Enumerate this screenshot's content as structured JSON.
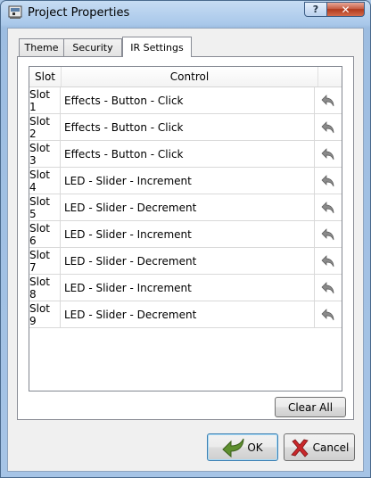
{
  "window": {
    "title": "Project Properties",
    "help_label": "?",
    "close_label": "✕"
  },
  "tabs": [
    {
      "label": "Theme",
      "active": false
    },
    {
      "label": "Security",
      "active": false
    },
    {
      "label": "IR Settings",
      "active": true
    }
  ],
  "table": {
    "columns": [
      "Slot",
      "Control"
    ],
    "rows": [
      {
        "slot": "Slot 1",
        "control": "Effects - Button - Click"
      },
      {
        "slot": "Slot 2",
        "control": "Effects - Button - Click"
      },
      {
        "slot": "Slot 3",
        "control": "Effects - Button - Click"
      },
      {
        "slot": "Slot 4",
        "control": "LED - Slider - Increment"
      },
      {
        "slot": "Slot 5",
        "control": "LED - Slider - Decrement"
      },
      {
        "slot": "Slot 6",
        "control": "LED - Slider - Increment"
      },
      {
        "slot": "Slot 7",
        "control": "LED - Slider - Decrement"
      },
      {
        "slot": "Slot 8",
        "control": "LED - Slider - Increment"
      },
      {
        "slot": "Slot 9",
        "control": "LED - Slider - Decrement"
      }
    ],
    "row_action_icon": "undo-arrow-icon"
  },
  "buttons": {
    "clear_all": "Clear All",
    "ok": "OK",
    "cancel": "Cancel"
  },
  "colors": {
    "title_bar": "#a9c6e6",
    "close_button": "#c75e45",
    "ok_icon": "#5a8a2e",
    "cancel_icon": "#c0282a"
  }
}
